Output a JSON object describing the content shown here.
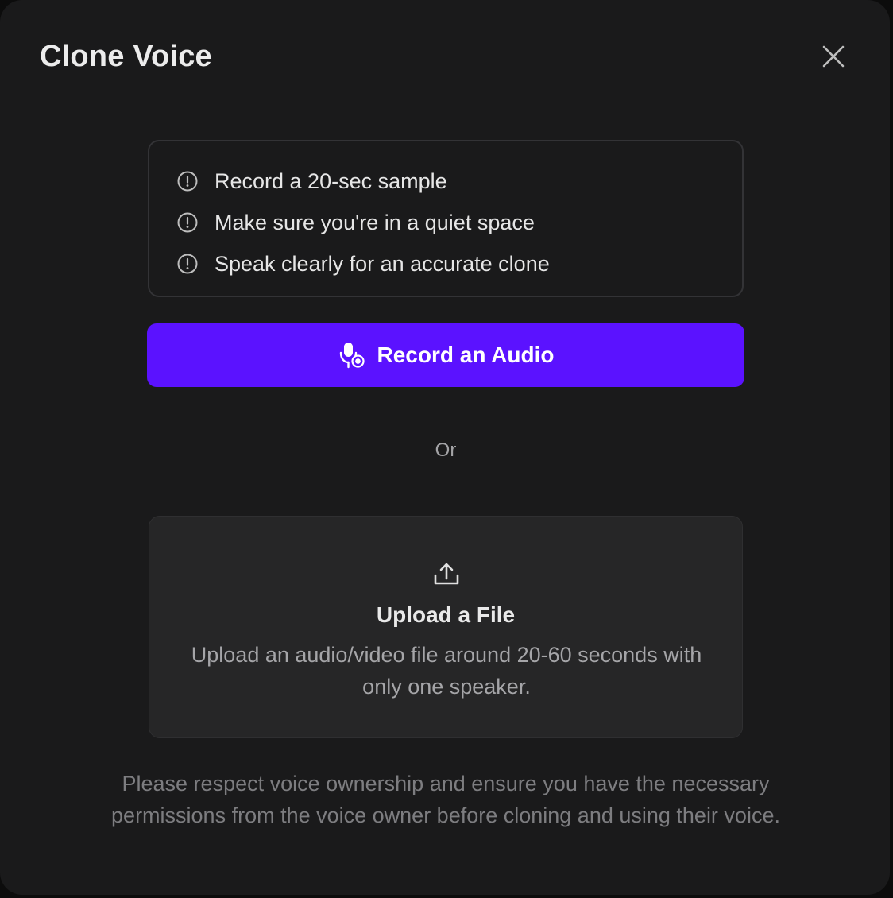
{
  "dialog": {
    "title": "Clone Voice",
    "close_icon": "close-icon"
  },
  "tips": {
    "icon": "info-circle-icon",
    "items": [
      {
        "label": "Record a 20-sec sample"
      },
      {
        "label": "Make sure you're in a quiet space"
      },
      {
        "label": "Speak clearly for an accurate clone"
      }
    ]
  },
  "record_button": {
    "label": "Record an Audio",
    "icon": "microphone-record-icon",
    "color": "#5b12ff"
  },
  "divider": {
    "label": "Or"
  },
  "upload": {
    "icon": "upload-icon",
    "title": "Upload a File",
    "description": "Upload an audio/video file around 20-60 seconds with only one speaker."
  },
  "notice": {
    "text": "Please respect voice ownership and ensure you have the necessary permissions from the voice owner before cloning and using their voice."
  }
}
